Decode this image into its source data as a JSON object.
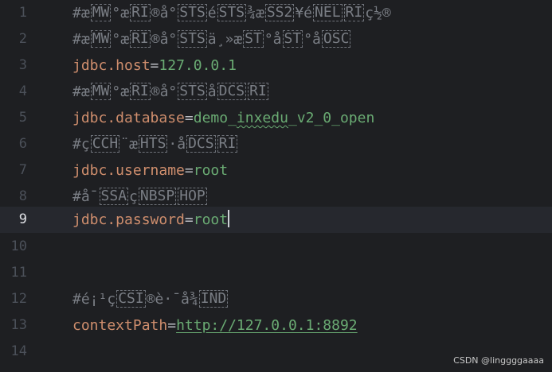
{
  "editor": {
    "lines": [
      {
        "number": "1",
        "comment_parts": [
          "#æ",
          "MW",
          "°æ",
          "RI",
          "®å°",
          "STS",
          "é",
          "STS",
          "¾æ",
          "SS2",
          "¥é",
          "NEL",
          "",
          "RI",
          "ç½®"
        ]
      },
      {
        "number": "2",
        "comment_parts": [
          "#æ",
          "MW",
          "°æ",
          "RI",
          "®å°",
          "STS",
          "ä¸»æ",
          "ST",
          "°å",
          "ST",
          "°å",
          "OSC",
          ""
        ]
      },
      {
        "number": "3",
        "key": "jdbc.host",
        "eq": "=",
        "value": "127.0.0.1"
      },
      {
        "number": "4",
        "comment_parts": [
          "#æ",
          "MW",
          "°æ",
          "RI",
          "®å°",
          "STS",
          "å",
          "DCS",
          "",
          "RI",
          ""
        ]
      },
      {
        "number": "5",
        "key": "jdbc.database",
        "eq": "=",
        "value_plain": "demo_",
        "value_typo": "inxedu",
        "value_rest": "_v2_0_open"
      },
      {
        "number": "6",
        "comment_parts": [
          "#ç",
          "CCH",
          "¨æ",
          "HTS",
          "·å",
          "DCS",
          "",
          "RI",
          ""
        ]
      },
      {
        "number": "7",
        "key": "jdbc.username",
        "eq": "=",
        "value": "root"
      },
      {
        "number": "8",
        "comment_parts": [
          "#å¯",
          "SSA",
          "ç",
          "NBSP",
          "",
          "HOP",
          ""
        ]
      },
      {
        "number": "9",
        "key": "jdbc.password",
        "eq": "=",
        "value": "root",
        "current": true
      },
      {
        "number": "10"
      },
      {
        "number": "11"
      },
      {
        "number": "12",
        "comment_parts": [
          "#é¡¹ç",
          "CSI",
          "®è·¯å¾",
          "IND",
          ""
        ]
      },
      {
        "number": "13",
        "key": "contextPath",
        "eq": "=",
        "url": "http://127.0.0.1:8892"
      },
      {
        "number": "14"
      }
    ]
  },
  "watermark": "CSDN @linggggaaaa",
  "colors": {
    "background": "#1e1f22",
    "current_line": "#26282e",
    "key": "#cf8e6d",
    "value": "#6aab73",
    "comment": "#7a7e85",
    "line_number": "#4b5059"
  }
}
